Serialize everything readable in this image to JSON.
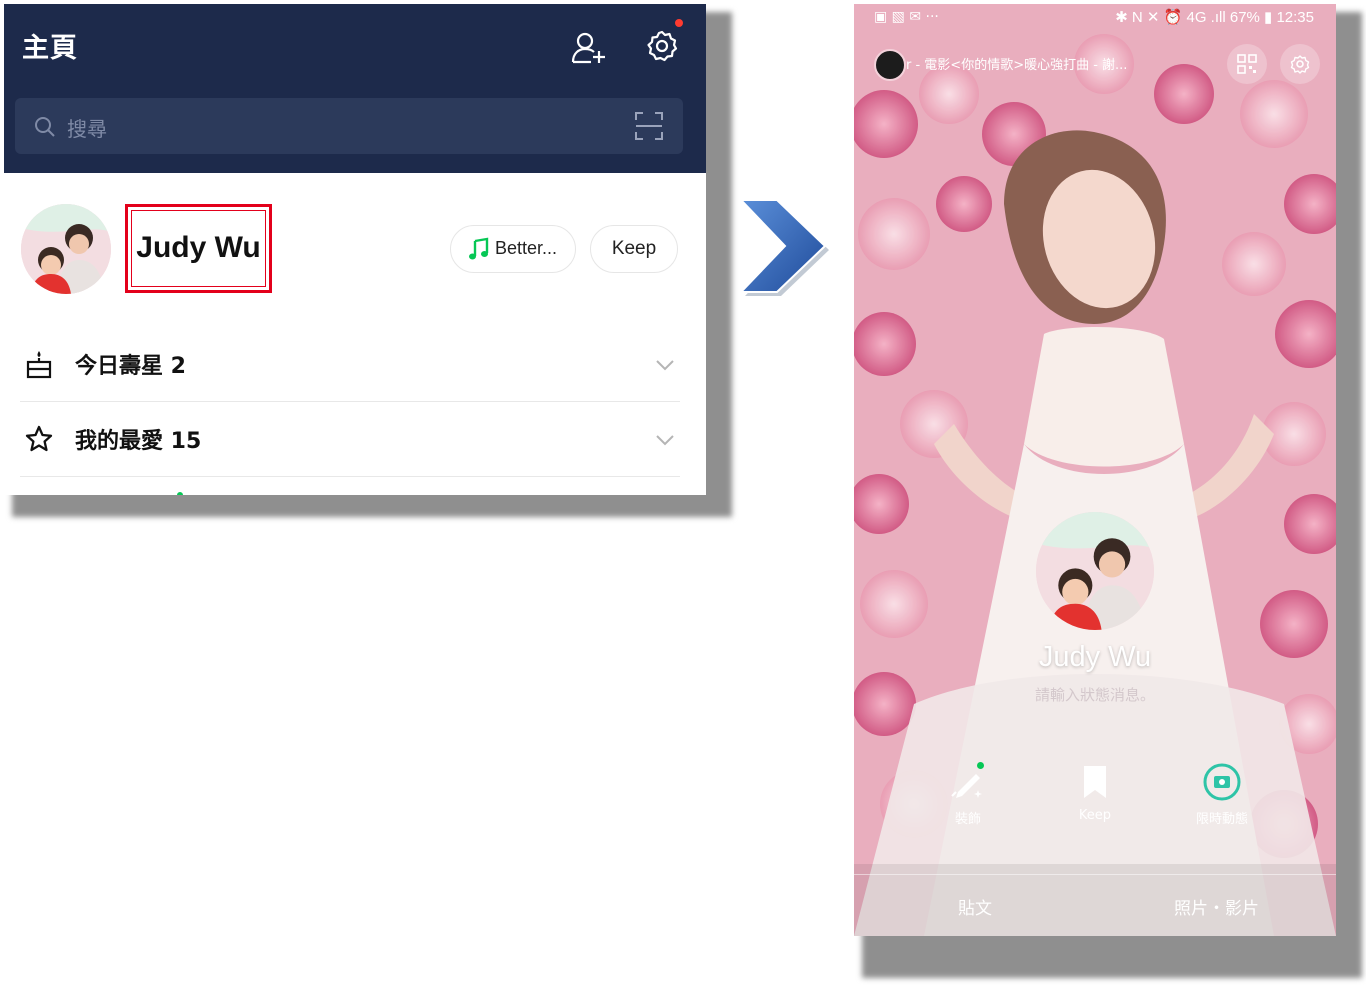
{
  "left_screen": {
    "header": {
      "title": "主頁"
    },
    "search": {
      "placeholder": "搜尋"
    },
    "profile": {
      "name": "Judy Wu",
      "music_chip": "Better...",
      "keep_chip": "Keep"
    },
    "sections": [
      {
        "label": "今日壽星 2",
        "icon": "cake-icon"
      },
      {
        "label": "我的最愛 15",
        "icon": "star-icon"
      }
    ],
    "colors": {
      "header_bg": "#1d2a4b",
      "highlight_box": "#e3001b",
      "accent_green": "#06c755"
    }
  },
  "arrow": {
    "icon": "chevron-right-arrow",
    "color": "#2a5aa8"
  },
  "right_screen": {
    "status_bar": {
      "left_icons": "▣ ▧ ✉ ···",
      "right_text": "✱ N ✕ ⏰ 4G .ıll 67% ▮ 12:35"
    },
    "music_ticker": "r - 電影<你的情歌>暖心強打曲 - 謝...",
    "profile": {
      "name": "Judy Wu",
      "status_placeholder": "請輸入狀態消息。"
    },
    "actions": [
      {
        "label": "裝飾",
        "icon": "pencil-icon"
      },
      {
        "label": "Keep",
        "icon": "bookmark-icon"
      },
      {
        "label": "限時動態",
        "icon": "story-camera-icon"
      }
    ],
    "tabs": {
      "posts": "貼文",
      "photos": "照片・影片"
    }
  }
}
